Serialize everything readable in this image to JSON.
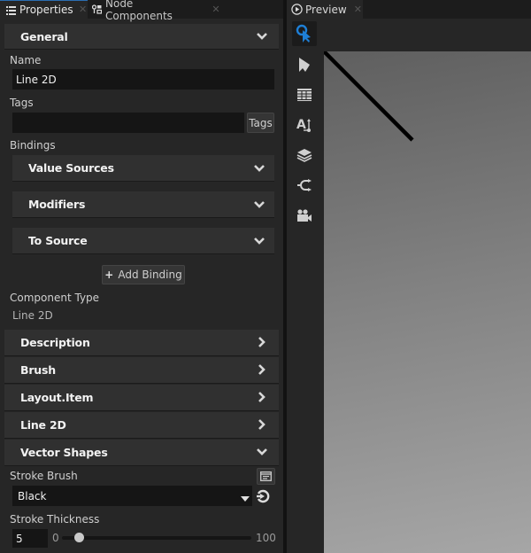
{
  "left_panel": {
    "tabs": [
      {
        "label": "Properties",
        "icon": "list-icon",
        "active": true
      },
      {
        "label": "Node Components",
        "icon": "node-components-icon",
        "active": false
      }
    ],
    "sections": {
      "general": {
        "label": "General",
        "expanded": true
      },
      "description": {
        "label": "Description",
        "expanded": false
      },
      "brush": {
        "label": "Brush",
        "expanded": false
      },
      "layout_item": {
        "label": "Layout.Item",
        "expanded": false
      },
      "line2d": {
        "label": "Line 2D",
        "expanded": false
      },
      "vector_shapes": {
        "label": "Vector Shapes",
        "expanded": true
      }
    },
    "name_label": "Name",
    "name_value": "Line 2D",
    "tags_label": "Tags",
    "tags_value": "",
    "tags_button": "Tags",
    "bindings_label": "Bindings",
    "bindings": [
      {
        "label": "Value Sources"
      },
      {
        "label": "Modifiers"
      },
      {
        "label": "To Source"
      }
    ],
    "add_binding_button": "Add Binding",
    "component_type_label": "Component Type",
    "component_type_value": "Line 2D",
    "stroke_brush_label": "Stroke Brush",
    "stroke_brush_value": "Black",
    "stroke_thickness_label": "Stroke Thickness",
    "stroke_thickness_value": "5",
    "slider_min": "0",
    "slider_max": "100",
    "slider_value": 5
  },
  "right_panel": {
    "tab_label": "Preview",
    "tools": [
      {
        "name": "interact-tool",
        "active": true
      },
      {
        "name": "select-tool",
        "active": false
      },
      {
        "name": "grid-tool",
        "active": false
      },
      {
        "name": "text-tool",
        "active": false
      },
      {
        "name": "layers-tool",
        "active": false
      },
      {
        "name": "connection-tool",
        "active": false
      },
      {
        "name": "camera-tool",
        "active": false
      }
    ],
    "accent_color": "#1e7fd6"
  }
}
